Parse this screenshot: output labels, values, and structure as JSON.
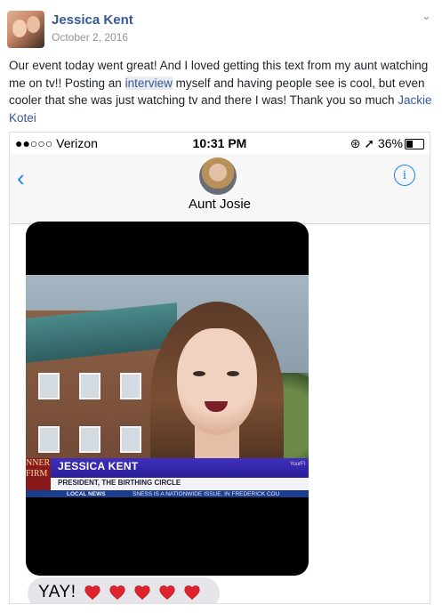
{
  "post": {
    "author": "Jessica Kent",
    "date": "October 2, 2016",
    "text_part1": "Our event today went great! And I loved getting this text from my aunt watching me on tv!! Posting an ",
    "link_interview": "interview",
    "text_part2": " myself and having people see is cool, but even cooler that she was just watching tv and there I was! Thank you so much ",
    "mention": "Jackie Kotei"
  },
  "phone": {
    "carrier": "●●○○○ Verizon",
    "time": "10:31 PM",
    "right_status": "⊛ ➚ 36%",
    "contact_name": "Aunt Josie",
    "back_icon": "chevron-left-icon",
    "info_icon": "info-icon"
  },
  "tv": {
    "name": "JESSICA KENT",
    "title": "PRESIDENT, THE BIRTHING CIRCLE",
    "local_news": "LOCAL NEWS",
    "ticker": "SNESS IS A NATIONWIDE ISSUE.  IN FREDERICK COU",
    "corner": "NNER\nFIRM",
    "brand": "YourFl"
  },
  "message": {
    "text": "YAY!",
    "heart_count": 5,
    "heart_color": "#e0242f"
  },
  "colors": {
    "link": "#365899",
    "ios_blue": "#1a82fb",
    "bubble": "#e5e5ea"
  }
}
